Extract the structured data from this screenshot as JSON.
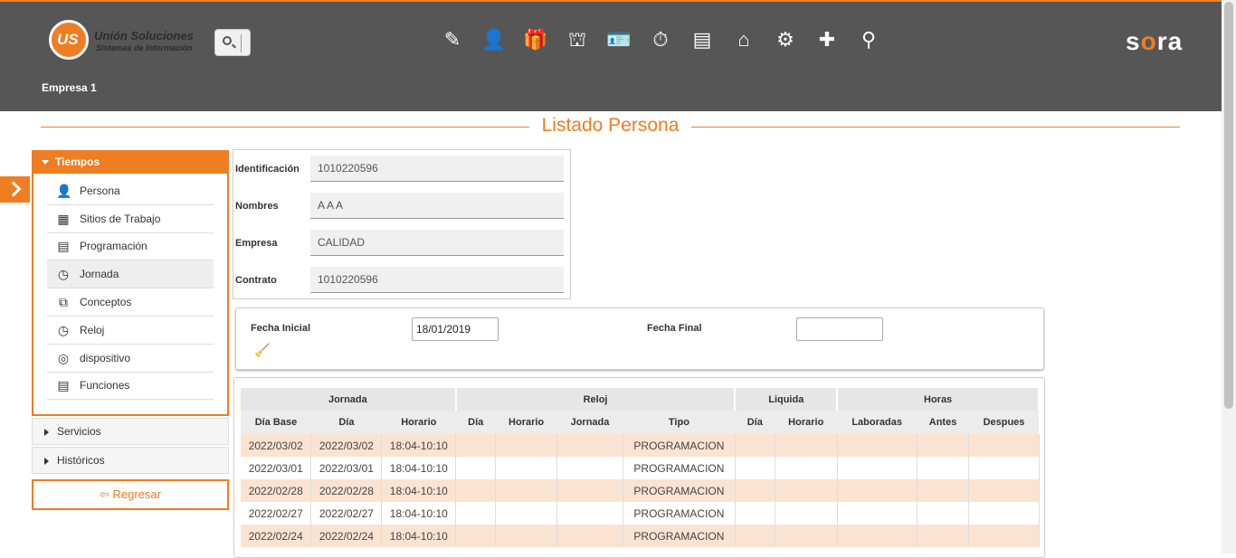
{
  "header": {
    "logo_name": "Unión Soluciones",
    "logo_sub": "Sistemas de Información",
    "logo_mark": "US",
    "brand": "sora",
    "empresa": "Empresa 1",
    "menu_icons": [
      "report-edit-icon",
      "person-icon",
      "gift-icon",
      "org-chart-icon",
      "id-card-icon",
      "timer-icon",
      "document-list-icon",
      "presentation-icon",
      "gears-icon",
      "medical-case-icon",
      "people-search-icon"
    ]
  },
  "page": {
    "title": "Listado Persona"
  },
  "sidebar": {
    "panel_title": "Tiempos",
    "items": [
      {
        "label": "Persona",
        "icon": "👤"
      },
      {
        "label": "Sitios de Trabajo",
        "icon": "▦"
      },
      {
        "label": "Programación",
        "icon": "▤"
      },
      {
        "label": "Jornada",
        "icon": "◷"
      },
      {
        "label": "Conceptos",
        "icon": "⧉"
      },
      {
        "label": "Reloj",
        "icon": "◷"
      },
      {
        "label": "dispositivo",
        "icon": "◎"
      },
      {
        "label": "Funciones",
        "icon": "▤"
      }
    ],
    "servicios": "Servicios",
    "historicos": "Históricos",
    "regresar": "Regresar"
  },
  "info": {
    "identificacion_label": "Identificación",
    "identificacion": "1010220596",
    "nombres_label": "Nombres",
    "nombres": "A A A",
    "empresa_label": "Empresa",
    "empresa": "CALIDAD",
    "contrato_label": "Contrato",
    "contrato": "1010220596"
  },
  "filters": {
    "fecha_inicial_label": "Fecha Inicial",
    "fecha_inicial": "18/01/2019",
    "fecha_final_label": "Fecha Final",
    "fecha_final": ""
  },
  "table": {
    "groups": [
      "Jornada",
      "Reloj",
      "Liquida",
      "Horas"
    ],
    "columns": [
      "Día Base",
      "Día",
      "Horario",
      "Día",
      "Horario",
      "Jornada",
      "Tipo",
      "Día",
      "Horario",
      "Laboradas",
      "Antes",
      "Despues"
    ],
    "rows": [
      [
        "2022/03/02",
        "2022/03/02",
        "18:04-10:10",
        "",
        "",
        "",
        "PROGRAMACION",
        "",
        "",
        "",
        "",
        ""
      ],
      [
        "2022/03/01",
        "2022/03/01",
        "18:04-10:10",
        "",
        "",
        "",
        "PROGRAMACION",
        "",
        "",
        "",
        "",
        ""
      ],
      [
        "2022/02/28",
        "2022/02/28",
        "18:04-10:10",
        "",
        "",
        "",
        "PROGRAMACION",
        "",
        "",
        "",
        "",
        ""
      ],
      [
        "2022/02/27",
        "2022/02/27",
        "18:04-10:10",
        "",
        "",
        "",
        "PROGRAMACION",
        "",
        "",
        "",
        "",
        ""
      ],
      [
        "2022/02/24",
        "2022/02/24",
        "18:04-10:10",
        "",
        "",
        "",
        "PROGRAMACION",
        "",
        "",
        "",
        "",
        ""
      ]
    ]
  },
  "colors": {
    "accent": "#ef7d22",
    "header_bg": "#565656",
    "row_alt": "#fbe3d2"
  }
}
